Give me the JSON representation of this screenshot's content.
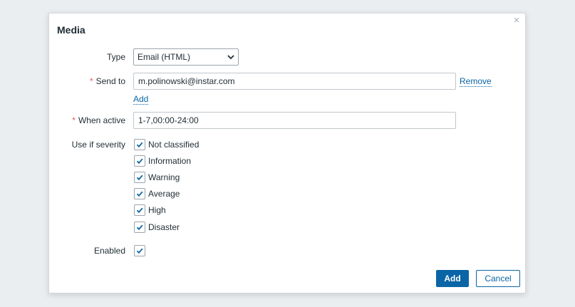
{
  "dialog": {
    "title": "Media",
    "close_symbol": "×"
  },
  "form": {
    "type_label": "Type",
    "type_value": "Email (HTML)",
    "required_marker": "*",
    "send_to_label": "Send to",
    "send_to_value": "m.polinowski@instar.com",
    "remove_link": "Remove",
    "add_link": "Add",
    "when_active_label": "When active",
    "when_active_value": "1-7,00:00-24:00",
    "severity_label": "Use if severity",
    "severities": [
      {
        "label": "Not classified",
        "checked": true
      },
      {
        "label": "Information",
        "checked": true
      },
      {
        "label": "Warning",
        "checked": true
      },
      {
        "label": "Average",
        "checked": true
      },
      {
        "label": "High",
        "checked": true
      },
      {
        "label": "Disaster",
        "checked": true
      }
    ],
    "enabled_label": "Enabled",
    "enabled_checked": true
  },
  "footer": {
    "add_button": "Add",
    "cancel_button": "Cancel"
  },
  "colors": {
    "accent": "#0a65a6",
    "required": "#e45959",
    "background": "#ebeef0"
  },
  "icons": {
    "close": "close-icon",
    "dropdown": "chevron-down-icon",
    "checkmark": "checkmark-icon"
  }
}
